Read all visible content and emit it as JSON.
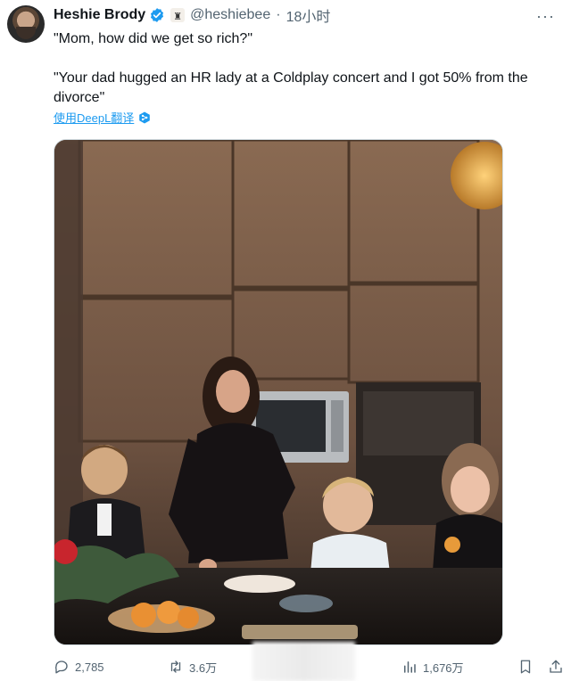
{
  "tweet": {
    "author_name": "Heshie Brody",
    "handle": "@heshiebee",
    "separator": "·",
    "time": "18小时",
    "text_line1": "\"Mom, how did we get so rich?\"",
    "text_line2": "\"Your dad hugged an HR lady at a Coldplay concert and I got 50% from the divorce\"",
    "translate_label": "使用DeepL翻译"
  },
  "stats": {
    "replies": "2,785",
    "retweets": "3.6万",
    "views": "1,676万"
  },
  "icons": {
    "verified": "verified-badge-icon",
    "more": "more-icon",
    "reply": "reply-icon",
    "retweet": "retweet-icon",
    "views": "views-icon",
    "bookmark": "bookmark-icon",
    "share": "share-icon",
    "translate": "deepl-icon"
  },
  "colors": {
    "accent": "#1d9bf0",
    "text_secondary": "#536471"
  }
}
